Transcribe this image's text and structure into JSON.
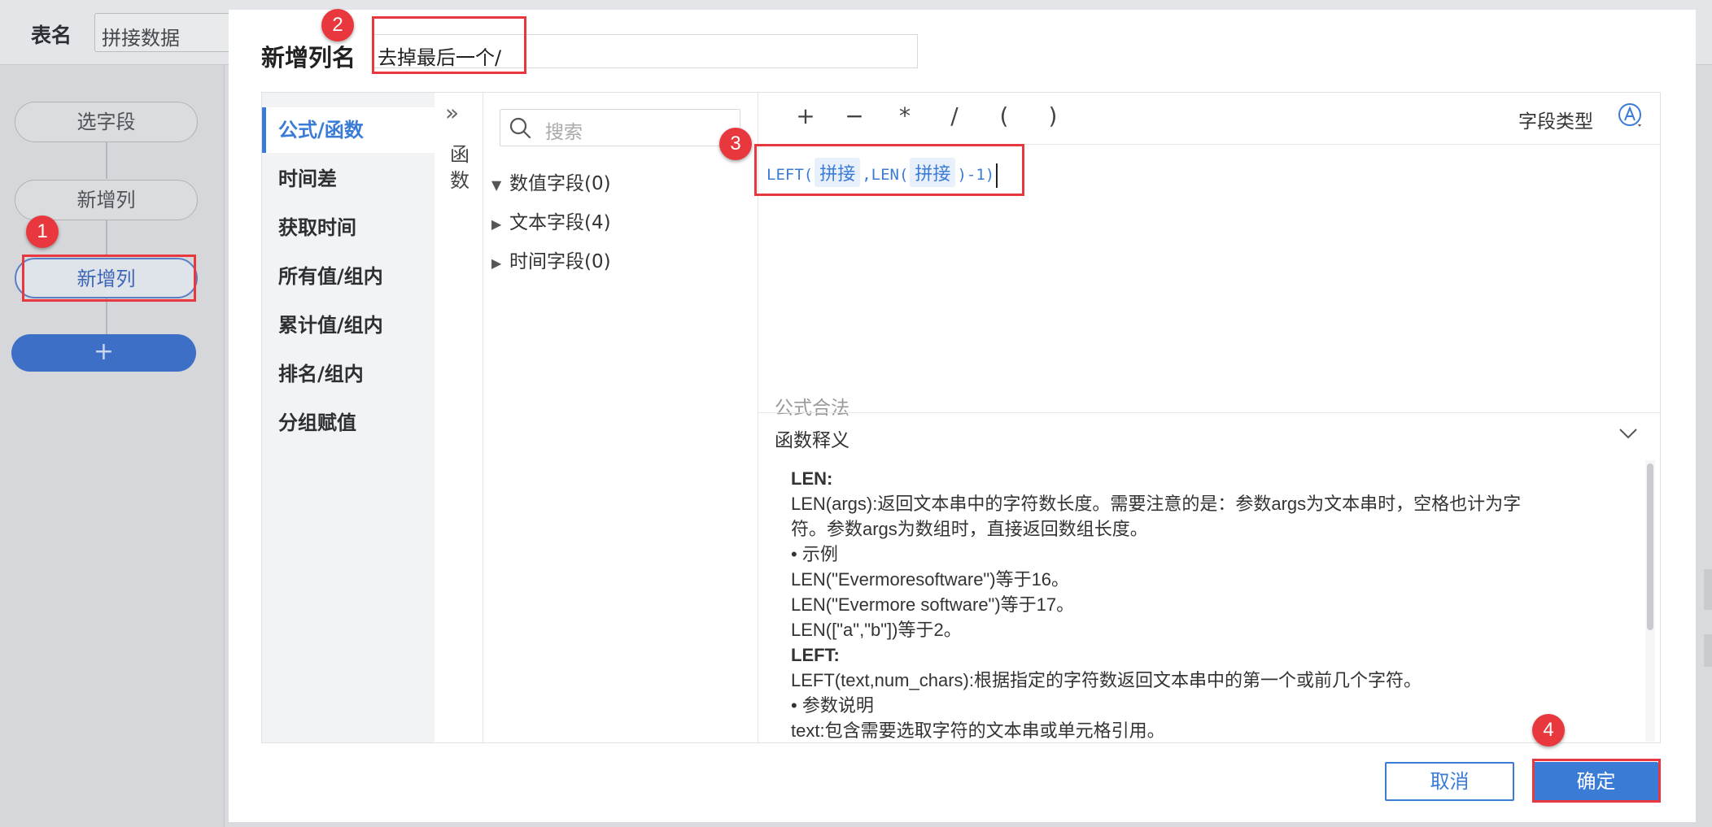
{
  "background": {
    "table_name_label": "表名",
    "table_name_value": "拼接数据",
    "steps": [
      "选字段",
      "新增列",
      "新增列"
    ],
    "add_step_label": "+"
  },
  "dialog": {
    "title": "新增列名",
    "name_value": "去掉最后一个/",
    "categories": [
      "公式/函数",
      "时间差",
      "获取时间",
      "所有值/组内",
      "累计值/组内",
      "排名/组内",
      "分组赋值"
    ],
    "function_strip_label": "函数",
    "search_placeholder": "搜索",
    "field_groups": [
      "数值字段(0)",
      "文本字段(4)",
      "时间字段(0)"
    ],
    "operators": [
      "+",
      "−",
      "*",
      "/",
      "(",
      ")"
    ],
    "field_type_label": "字段类型",
    "formula": {
      "part1": "LEFT(",
      "token1": "拼接",
      "part2": ",LEN(",
      "token2": "拼接",
      "part3": ")-1)"
    },
    "formula_status": "公式合法",
    "help_title": "函数释义",
    "help_lines": [
      "LEN:",
      "LEN(args):返回文本串中的字符数长度。需要注意的是：参数args为文本串时，空格也计为字",
      "符。参数args为数组时，直接返回数组长度。",
      "• 示例",
      "LEN(\"Evermoresoftware\")等于16。",
      "LEN(\"Evermore software\")等于17。",
      "LEN([\"a\",\"b\"])等于2。",
      "LEFT:",
      "LEFT(text,num_chars):根据指定的字符数返回文本串中的第一个或前几个字符。",
      "• 参数说明",
      "text:包含需要选取字符的文本串或单元格引用。"
    ],
    "cancel_label": "取消",
    "ok_label": "确定"
  },
  "annotations": [
    "1",
    "2",
    "3",
    "4"
  ],
  "colors": {
    "accent": "#3a7bd5",
    "annotation_red": "#e8383d"
  }
}
